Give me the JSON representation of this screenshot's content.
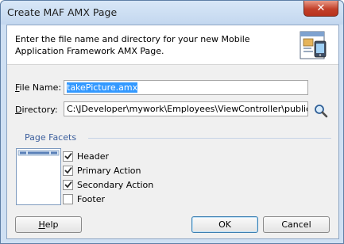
{
  "window": {
    "title": "Create MAF AMX Page",
    "close_glyph": "✕"
  },
  "header": {
    "instructions": "Enter the file name and directory for your new Mobile Application Framework AMX Page.",
    "icon": "amx-page-wizard-icon"
  },
  "form": {
    "file_name_label_mnemonic": "F",
    "file_name_label_rest": "ile Name:",
    "file_name_value": "takePicture.amx",
    "directory_label_mnemonic": "D",
    "directory_label_rest": "irectory:",
    "directory_value": "C:\\JDeveloper\\mywork\\Employees\\ViewController\\public_html",
    "browse_icon": "search-icon"
  },
  "facets": {
    "section_label": "Page Facets",
    "items": [
      {
        "label": "Header",
        "checked": true
      },
      {
        "label": "Primary Action",
        "checked": true
      },
      {
        "label": "Secondary Action",
        "checked": true
      },
      {
        "label": "Footer",
        "checked": false
      }
    ]
  },
  "buttons": {
    "help_mnemonic": "H",
    "help_rest": "elp",
    "ok": "OK",
    "cancel": "Cancel"
  },
  "colors": {
    "selection": "#3399ff",
    "section_label": "#3b5e9c",
    "title_bar": "#c3d7ef"
  }
}
